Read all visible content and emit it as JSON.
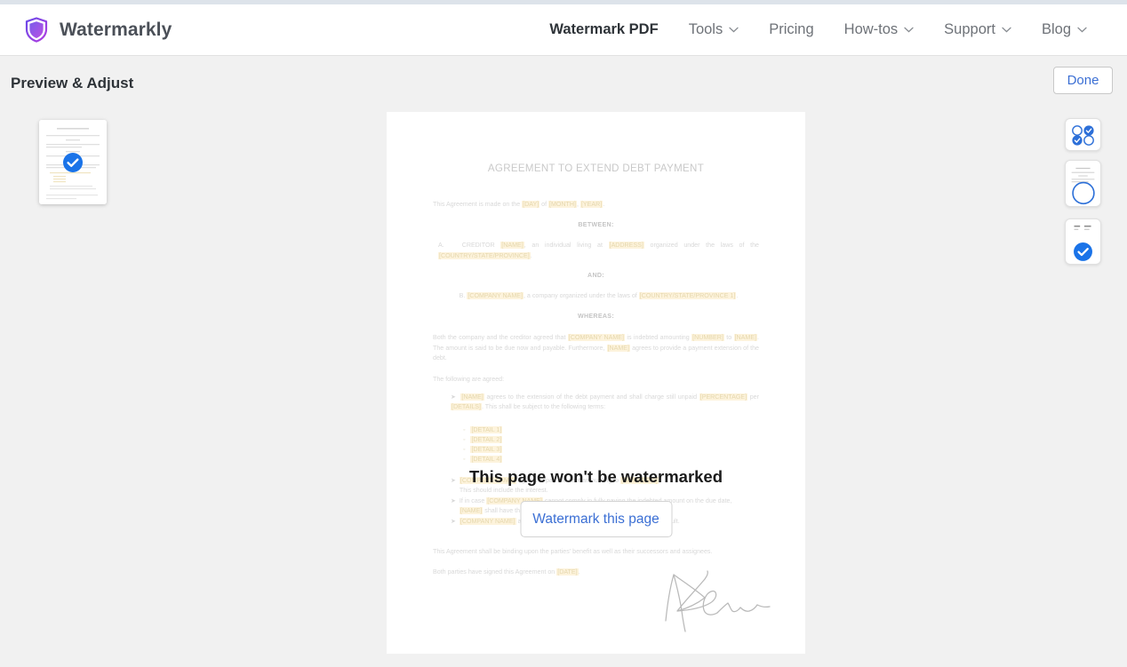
{
  "brand": {
    "name": "Watermarkly",
    "logo_icon": "shield-icon",
    "logo_color": "#7b3fe4"
  },
  "nav": {
    "items": [
      {
        "label": "Watermark PDF",
        "active": true,
        "has_caret": false
      },
      {
        "label": "Tools",
        "active": false,
        "has_caret": true
      },
      {
        "label": "Pricing",
        "active": false,
        "has_caret": false
      },
      {
        "label": "How-tos",
        "active": false,
        "has_caret": true
      },
      {
        "label": "Support",
        "active": false,
        "has_caret": true
      },
      {
        "label": "Blog",
        "active": false,
        "has_caret": true
      }
    ]
  },
  "toolbar": {
    "title": "Preview & Adjust",
    "done_label": "Done"
  },
  "thumbnails": {
    "pages": [
      {
        "index": 1,
        "selected": true,
        "badge_icon": "check-circle-icon"
      }
    ]
  },
  "overlay": {
    "message": "This page won't be watermarked",
    "button_label": "Watermark this page",
    "button_color": "#3b6fd4"
  },
  "tools": {
    "buttons": [
      {
        "name": "select-pages-button",
        "icon": "four-circles-select-icon"
      },
      {
        "name": "zoom-preview-button",
        "icon": "page-magnifier-icon"
      },
      {
        "name": "mark-page-button",
        "icon": "page-check-badge-icon"
      }
    ]
  },
  "document": {
    "title": "AGREEMENT TO EXTEND DEBT PAYMENT",
    "intro": "This Agreement is made on the [DAY] of [MONTH], [YEAR].",
    "heading_between": "BETWEEN:",
    "party_a": "A.  CREDITOR [NAME], an individual living at [ADDRESS] organized under the laws of the [COUNTRY/STATE/PROVINCE].",
    "heading_and": "AND:",
    "party_b": "B. [COMPANY NAME], a company organized under the laws of [COUNTRY/STATE/PROVINCE 1].",
    "heading_whereas": "WHEREAS:",
    "recital": "Both the company and the creditor agreed that [COMPANY NAME] is indebted amounting [NUMBER] to [NAME]. The amount is said to be due now and payable. Furthermore, [NAME] agrees to provide a payment extension of the debt.",
    "agreed_lead": "The following are agreed:",
    "clause_1": "[NAME] agrees to the extension of the debt payment and shall charge still unpaid [PERCENTAGE] per [DETAILS]. This shall be subject to the following terms:",
    "sub_items": [
      "[DETAIL 1]",
      "[DETAIL 2]",
      "[DETAIL 3]",
      "[DETAIL 4]"
    ],
    "clause_2": "[COMPANY NAME] agrees to pay the debt amounting to [NUMBER 1]. This should include the interest.",
    "clause_3": "If in case [COMPANY NAME] cannot comply in fully paying the indebted amount on the due date, [NAME] shall have the full rights to collect the overall balance.",
    "clause_4": "[COMPANY NAME] agrees to pay all sums of collection in the event of default.",
    "binding": "This Agreement shall be binding upon the parties' benefit as well as their successors and assignees.",
    "signed_on": "Both parties have signed this Agreement on [DATE].",
    "signature_label": "handwritten-signature"
  },
  "colors": {
    "page_bg": "#f1f1f1",
    "accent_blue": "#1a73e8",
    "link_blue": "#3b6fd4",
    "highlight": "#fdf3dc"
  }
}
